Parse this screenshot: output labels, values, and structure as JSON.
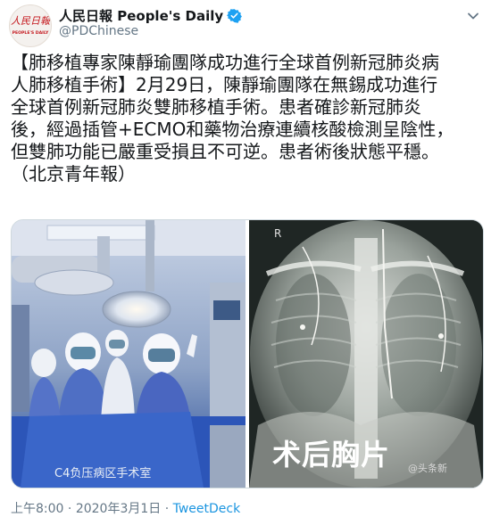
{
  "author": {
    "display_name": "人民日報 People's Daily",
    "handle": "@PDChinese",
    "avatar_text": "人民日報",
    "avatar_subtext": "PEOPLE'S DAILY"
  },
  "tweet": {
    "lines": [
      "【肺移植專家陳靜瑜團隊成功進行全球首例新冠肺炎病",
      "人肺移植手術】2月29日，陳靜瑜團隊在無錫成功進行",
      "全球首例新冠肺炎雙肺移植手術。患者確診新冠肺炎",
      "後，經過插管+ECMO和藥物治療連續核酸檢測呈陰性，",
      "但雙肺功能已嚴重受損且不可逆。患者術後狀態平穩。",
      "（北京青年報）"
    ]
  },
  "media": {
    "left_caption": "C4负压病区手术室",
    "right_caption": "术后胸片",
    "right_marker": "R",
    "watermark": "@头条新"
  },
  "meta": {
    "time": "上午8:00",
    "separator": " · ",
    "date": "2020年3月1日",
    "separator2": " · ",
    "source": "TweetDeck"
  },
  "colors": {
    "verified": "#1da1f2",
    "link": "#1b95e0",
    "secondary_text": "#657786",
    "avatar_red": "#c4161c"
  }
}
